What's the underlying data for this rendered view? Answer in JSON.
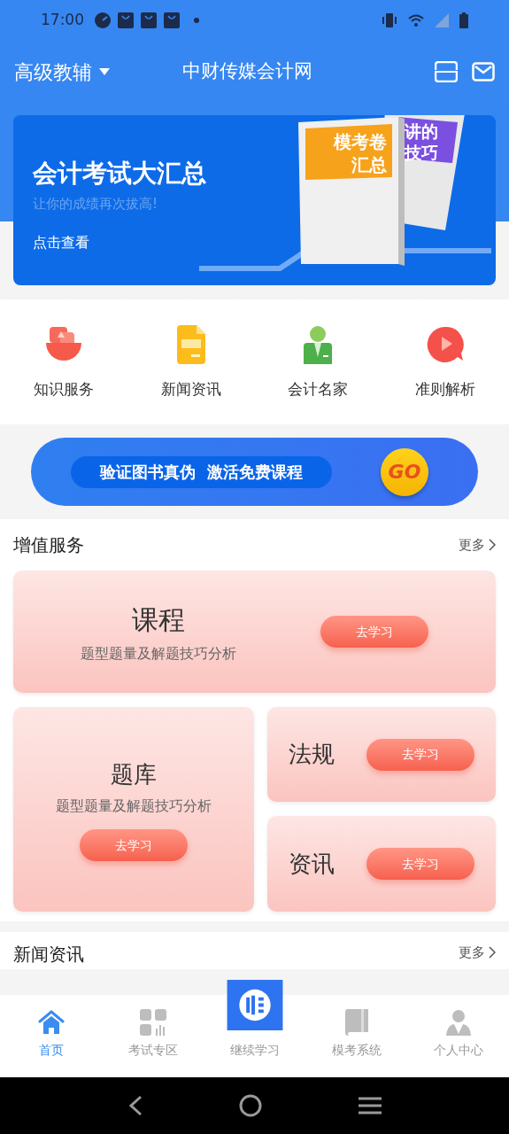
{
  "status_bar": {
    "time": "17:00"
  },
  "header": {
    "selector": "高级教辅",
    "title": "中财传媒会计网"
  },
  "banner": {
    "title": "会计考试大汇总",
    "subtitle": "让你的成绩再次拔高!",
    "link": "点击查看",
    "book_front": [
      "模考卷",
      "汇总"
    ],
    "book_back": [
      "讲的",
      "技巧"
    ]
  },
  "quick_links": [
    {
      "kind": "knowledge",
      "label": "知识服务"
    },
    {
      "kind": "news",
      "label": "新闻资讯"
    },
    {
      "kind": "expert",
      "label": "会计名家"
    },
    {
      "kind": "video",
      "label": "准则解析"
    }
  ],
  "promo": {
    "text_1": "验证图书真伪",
    "text_2": "激活免费课程",
    "go": "GO"
  },
  "value_services": {
    "title": "增值服务",
    "more": "更多",
    "cards": [
      {
        "kind": "wide",
        "title": "课程",
        "subtitle": "题型题量及解题技巧分析",
        "button": "去学习"
      },
      {
        "kind": "tall",
        "title": "题库",
        "subtitle": "题型题量及解题技巧分析",
        "button": "去学习"
      },
      {
        "kind": "small",
        "title": "法规",
        "button": "去学习"
      },
      {
        "kind": "small",
        "title": "资讯",
        "button": "去学习"
      }
    ]
  },
  "news": {
    "title": "新闻资讯",
    "more": "更多"
  },
  "tab_bar": [
    {
      "kind": "home",
      "label": "首页",
      "selected": true
    },
    {
      "kind": "grid",
      "label": "考试专区",
      "selected": false
    },
    {
      "kind": "logo",
      "label": "继续学习",
      "selected": false
    },
    {
      "kind": "book",
      "label": "模考系统",
      "selected": false
    },
    {
      "kind": "person",
      "label": "个人中心",
      "selected": false
    }
  ]
}
